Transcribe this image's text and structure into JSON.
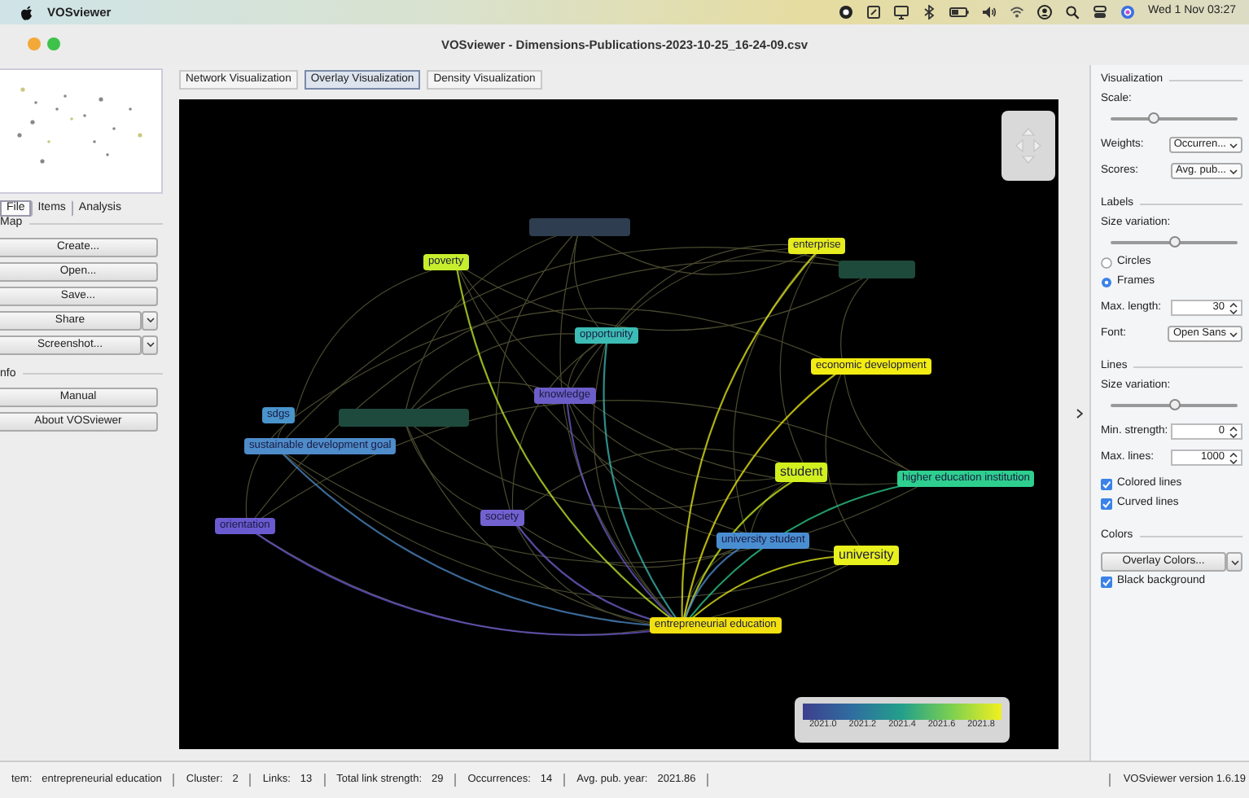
{
  "menubar": {
    "app": "VOSviewer",
    "clock": "Wed 1 Nov 03:27"
  },
  "window": {
    "title": "VOSviewer - Dimensions-Publications-2023-10-25_16-24-09.csv"
  },
  "view_tabs": [
    {
      "label": "Network Visualization",
      "selected": false
    },
    {
      "label": "Overlay Visualization",
      "selected": true
    },
    {
      "label": "Density Visualization",
      "selected": false
    }
  ],
  "left_tabs": [
    {
      "label": "File",
      "selected": true
    },
    {
      "label": "Items",
      "selected": false
    },
    {
      "label": "Analysis",
      "selected": false
    }
  ],
  "left_groups": [
    {
      "title": "Map",
      "buttons": [
        {
          "label": "Create...",
          "dropdown": false
        },
        {
          "label": "Open...",
          "dropdown": false
        },
        {
          "label": "Save...",
          "dropdown": false
        },
        {
          "label": "Share",
          "dropdown": true
        },
        {
          "label": "Screenshot...",
          "dropdown": true
        }
      ]
    },
    {
      "title": "nfo",
      "buttons": [
        {
          "label": "Manual",
          "dropdown": false
        },
        {
          "label": "About VOSviewer",
          "dropdown": false
        }
      ]
    }
  ],
  "nodes": [
    {
      "kind": "faded",
      "color": "#2e3d4f"
    },
    {
      "kind": "label",
      "label": "poverty",
      "color": "#c6ee2c"
    },
    {
      "kind": "label",
      "label": "enterprise",
      "color": "#e6ec1e"
    },
    {
      "kind": "faded",
      "color": "#1e4a3b"
    },
    {
      "kind": "label",
      "label": "opportunity",
      "color": "#3cbcb4"
    },
    {
      "kind": "label",
      "label": "economic development",
      "color": "#f2ec12"
    },
    {
      "kind": "label",
      "label": "knowledge",
      "color": "#6c5ec8"
    },
    {
      "kind": "label",
      "label": "sdgs",
      "color": "#4a94cc"
    },
    {
      "kind": "faded",
      "color": "#1e4a3d"
    },
    {
      "kind": "label",
      "label": "sustainable development goal",
      "color": "#4e8cca"
    },
    {
      "kind": "label",
      "label": "student",
      "color": "#d2f01e"
    },
    {
      "kind": "label",
      "label": "higher education institution",
      "color": "#2ecf8e"
    },
    {
      "kind": "label",
      "label": "society",
      "color": "#7262d0"
    },
    {
      "kind": "label",
      "label": "orientation",
      "color": "#6a5ad0"
    },
    {
      "kind": "label",
      "label": "university student",
      "color": "#4a8ed2"
    },
    {
      "kind": "label",
      "label": "university",
      "color": "#e8f01e"
    },
    {
      "kind": "label",
      "label": "entrepreneurial education",
      "color": "#f2e010"
    }
  ],
  "legend": {
    "ticks": [
      "2021.0",
      "2021.2",
      "2021.4",
      "2021.6",
      "2021.8"
    ]
  },
  "right_panel": [
    {
      "kind": "group",
      "label": "Visualization"
    },
    {
      "kind": "label",
      "label": "Scale:"
    },
    {
      "kind": "slider",
      "level": 0.33
    },
    {
      "kind": "select",
      "label": "Weights:",
      "value": "Occurren..."
    },
    {
      "kind": "select",
      "label": "Scores:",
      "value": "Avg. pub..."
    },
    {
      "kind": "group",
      "label": "Labels"
    },
    {
      "kind": "label",
      "label": "Size variation:"
    },
    {
      "kind": "slider",
      "level": 0.5
    },
    {
      "kind": "radio",
      "label": "Circles",
      "selected": false
    },
    {
      "kind": "radio",
      "label": "Frames",
      "selected": true
    },
    {
      "kind": "spinner",
      "label": "Max. length:",
      "value": "30"
    },
    {
      "kind": "select",
      "label": "Font:",
      "value": "Open Sans"
    },
    {
      "kind": "group",
      "label": "Lines"
    },
    {
      "kind": "label",
      "label": "Size variation:"
    },
    {
      "kind": "slider",
      "level": 0.5
    },
    {
      "kind": "spinner",
      "label": "Min. strength:",
      "value": "0"
    },
    {
      "kind": "spinner",
      "label": "Max. lines:",
      "value": "1000"
    },
    {
      "kind": "checkbox",
      "label": "Colored lines",
      "checked": true
    },
    {
      "kind": "checkbox",
      "label": "Curved lines",
      "checked": true
    },
    {
      "kind": "group",
      "label": "Colors"
    },
    {
      "kind": "splitbutton",
      "label": "Overlay Colors..."
    },
    {
      "kind": "checkbox",
      "label": "Black background",
      "checked": true
    }
  ],
  "status_bar": {
    "fields": [
      {
        "label": "tem:",
        "value": "entrepreneurial education"
      },
      {
        "label": "Cluster:",
        "value": "2"
      },
      {
        "label": "Links:",
        "value": "13"
      },
      {
        "label": "Total link strength:",
        "value": "29"
      },
      {
        "label": "Occurrences:",
        "value": "14"
      },
      {
        "label": "Avg. pub. year:",
        "value": "2021.86"
      }
    ],
    "version": "VOSviewer version 1.6.19"
  }
}
